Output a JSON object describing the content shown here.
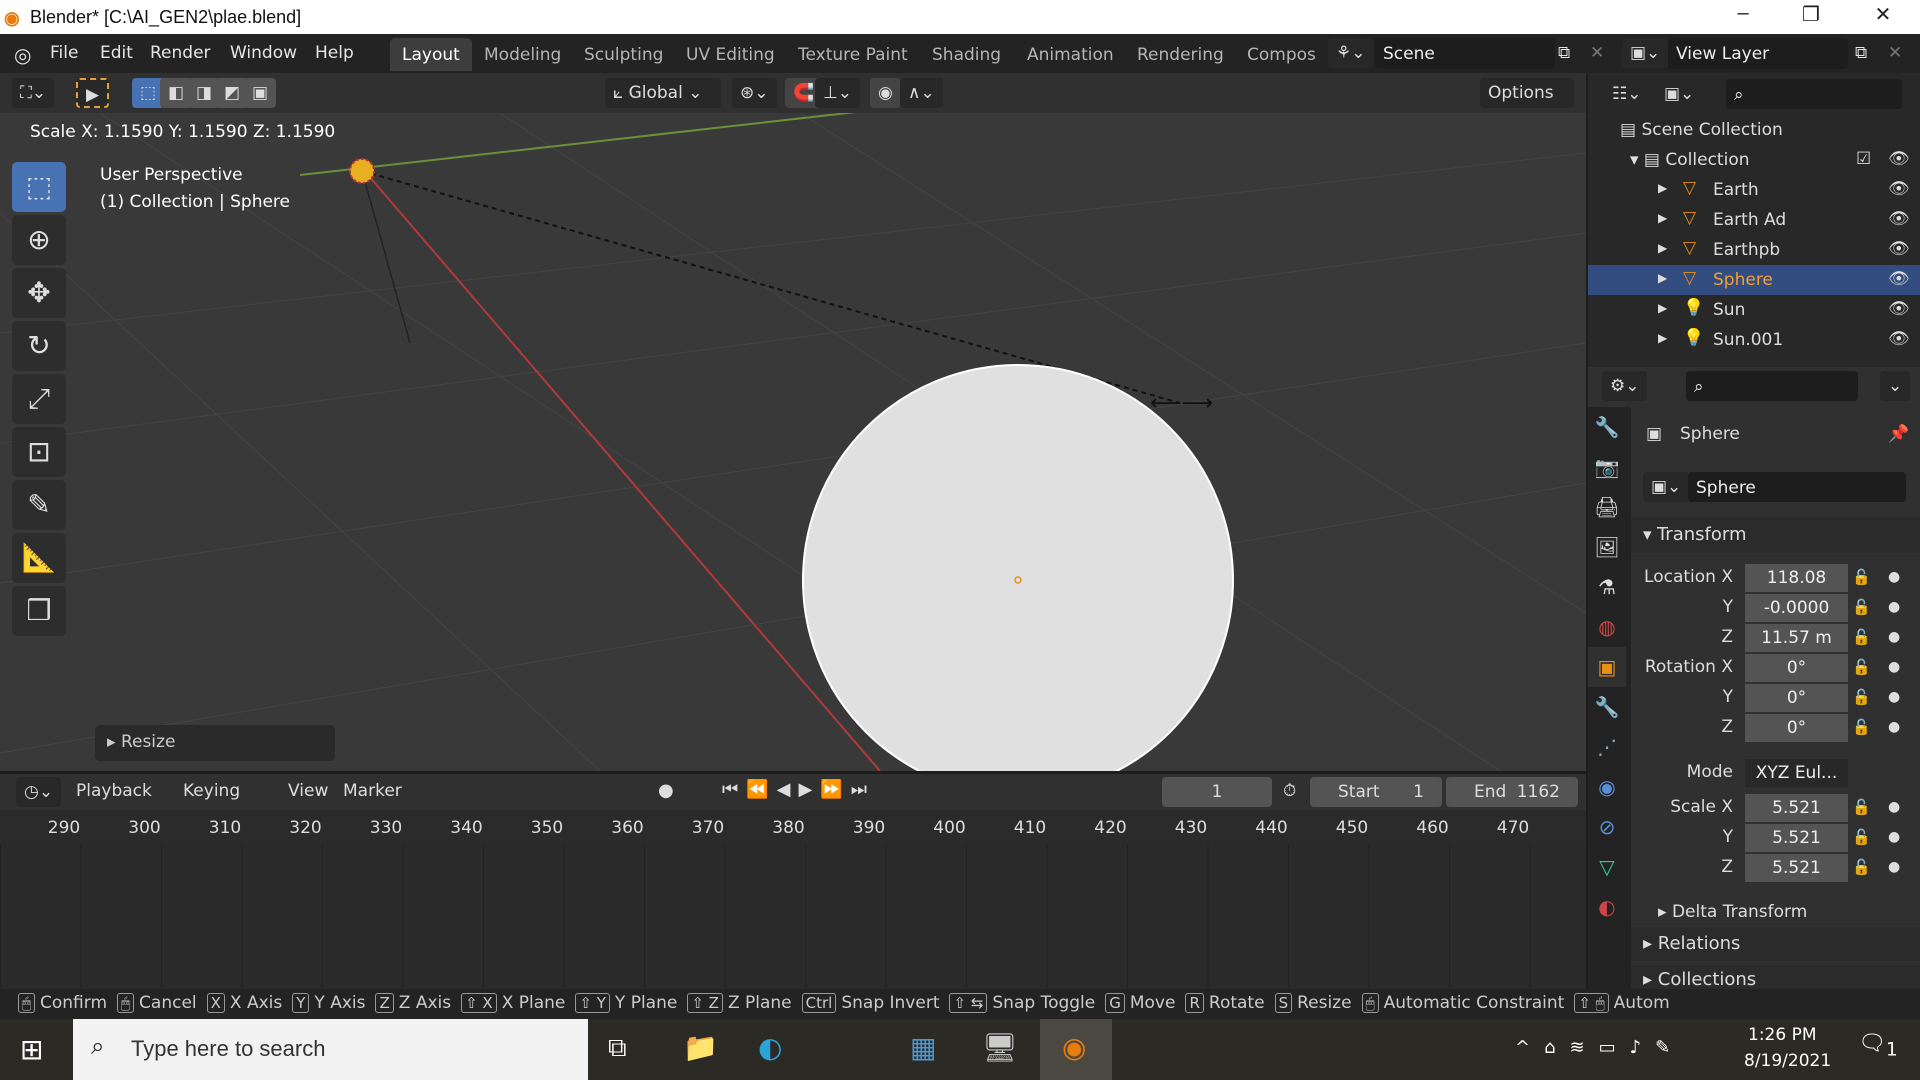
{
  "window": {
    "title": "Blender* [C:\\AI_GEN2\\plae.blend]",
    "minimize": "–",
    "maximize": "❐",
    "close": "✕"
  },
  "menu": [
    "File",
    "Edit",
    "Render",
    "Window",
    "Help"
  ],
  "workspaces": [
    {
      "label": "Layout",
      "active": true
    },
    {
      "label": "Modeling"
    },
    {
      "label": "Sculpting"
    },
    {
      "label": "UV Editing"
    },
    {
      "label": "Texture Paint"
    },
    {
      "label": "Shading"
    },
    {
      "label": "Animation"
    },
    {
      "label": "Rendering"
    },
    {
      "label": "Compos"
    }
  ],
  "scene": "Scene",
  "view_layer": "View Layer",
  "viewport": {
    "transform_orientation": "Global",
    "options": "Options",
    "operator_readout": "Scale X: 1.1590   Y: 1.1590   Z: 1.1590",
    "perspective": "User Perspective",
    "context": "(1) Collection | Sphere",
    "last_op_panel": "Resize",
    "sphere_color": "#e0e0e0",
    "bg_color": "#393939"
  },
  "timeline": {
    "menus": [
      "Playback",
      "Keying",
      "View",
      "Marker"
    ],
    "current_frame": "1",
    "start_label": "Start",
    "start": "1",
    "end_label": "End",
    "end": "1162",
    "ticks": [
      "290",
      "300",
      "310",
      "320",
      "330",
      "340",
      "350",
      "360",
      "370",
      "380",
      "390",
      "400",
      "410",
      "420",
      "430",
      "440",
      "450",
      "460",
      "470"
    ]
  },
  "outliner": {
    "root": "Scene Collection",
    "collection": "Collection",
    "items": [
      {
        "name": "Earth",
        "type": "mesh"
      },
      {
        "name": "Earth Ad",
        "type": "mesh"
      },
      {
        "name": "Earthpb",
        "type": "mesh"
      },
      {
        "name": "Sphere",
        "type": "mesh",
        "selected": true
      },
      {
        "name": "Sun",
        "type": "light"
      },
      {
        "name": "Sun.001",
        "type": "light"
      }
    ]
  },
  "properties": {
    "object_name": "Sphere",
    "data_name": "Sphere",
    "transform_label": "Transform",
    "location": {
      "label": "Location X",
      "x": "118.08",
      "y": "-0.0000",
      "z": "11.57 m"
    },
    "rotation": {
      "label": "Rotation X",
      "x": "0°",
      "y": "0°",
      "z": "0°"
    },
    "mode_label": "Mode",
    "mode": "XYZ Eul...",
    "scale": {
      "label": "Scale X",
      "x": "5.521",
      "y": "5.521",
      "z": "5.521"
    },
    "axis_y": "Y",
    "axis_z": "Z",
    "delta": "Delta Transform",
    "relations": "Relations",
    "collections": "Collections"
  },
  "status": [
    {
      "k": "🖱",
      "t": "Confirm"
    },
    {
      "k": "🖱",
      "t": "Cancel"
    },
    {
      "k": "X",
      "t": "X Axis"
    },
    {
      "k": "Y",
      "t": "Y Axis"
    },
    {
      "k": "Z",
      "t": "Z Axis"
    },
    {
      "k": "⇧ X",
      "t": "X Plane"
    },
    {
      "k": "⇧ Y",
      "t": "Y Plane"
    },
    {
      "k": "⇧ Z",
      "t": "Z Plane"
    },
    {
      "k": "Ctrl",
      "t": "Snap Invert"
    },
    {
      "k": "⇧ ⇆",
      "t": "Snap Toggle"
    },
    {
      "k": "G",
      "t": "Move"
    },
    {
      "k": "R",
      "t": "Rotate"
    },
    {
      "k": "S",
      "t": "Resize"
    },
    {
      "k": "🖱",
      "t": "Automatic Constraint"
    },
    {
      "k": "⇧ 🖱",
      "t": "Autom"
    }
  ],
  "taskbar": {
    "search_placeholder": "Type here to search",
    "time": "1:26 PM",
    "date": "8/19/2021",
    "notifications": "1"
  }
}
